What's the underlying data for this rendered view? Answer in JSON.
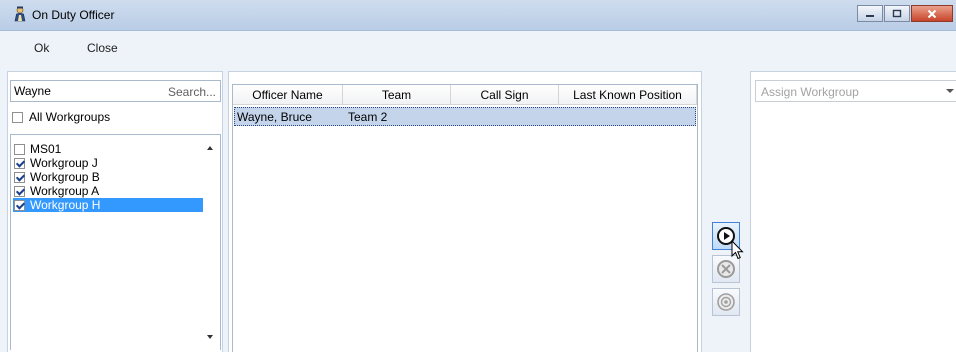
{
  "window": {
    "title": "On Duty Officer",
    "accent_color": "#3399ff",
    "icons": [
      "officer-icon",
      "minimize-icon",
      "maximize-icon",
      "close-icon"
    ]
  },
  "menu": {
    "ok_label": "Ok",
    "close_label": "Close"
  },
  "filter": {
    "search_value": "Wayne",
    "search_link": "Search...",
    "all_workgroups_label": "All Workgroups",
    "all_workgroups_checked": false
  },
  "workgroups": [
    {
      "label": "MS01",
      "checked": false,
      "selected": false
    },
    {
      "label": "Workgroup J",
      "checked": true,
      "selected": false
    },
    {
      "label": "Workgroup B",
      "checked": true,
      "selected": false
    },
    {
      "label": "Workgroup A",
      "checked": true,
      "selected": false
    },
    {
      "label": "Workgroup H",
      "checked": true,
      "selected": true
    }
  ],
  "officers_table": {
    "columns": [
      "Officer Name",
      "Team",
      "Call Sign",
      "Last Known Position"
    ],
    "rows": [
      {
        "officer_name": "Wayne, Bruce",
        "team": "Team 2",
        "call_sign": "",
        "last_known_position": ""
      }
    ]
  },
  "actions": {
    "icons": [
      "play-circle-icon",
      "cancel-circle-icon",
      "radio-circle-icon"
    ],
    "enabled": [
      true,
      false,
      false
    ]
  },
  "assign": {
    "placeholder": "Assign Workgroup"
  }
}
